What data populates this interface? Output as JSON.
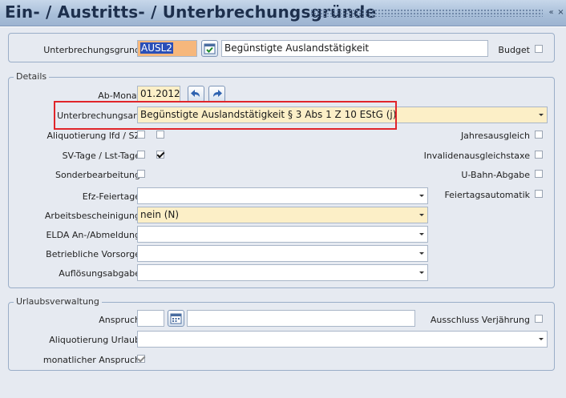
{
  "window": {
    "title": "Ein- / Austritts- / Unterbrechungsgründe",
    "btn_restore": "«",
    "btn_close": "×"
  },
  "top": {
    "grund_label": "Unterbrechungsgrund",
    "grund_code": "AUSL2",
    "grund_text": "Begünstigte Auslandstätigkeit",
    "budget_label": "Budget"
  },
  "details": {
    "legend": "Details",
    "abmonat_label": "Ab-Monat",
    "abmonat_value": "01.2012",
    "art_label": "Unterbrechungsart",
    "art_value": "Begünstigte Auslandstätigkeit § 3 Abs 1 Z 10 EStG (j)",
    "aliq_label": "Aliquotierung lfd / SZ",
    "svtage_label": "SV-Tage / Lst-Tage",
    "sonder_label": "Sonderbearbeitung",
    "efz_label": "Efz-Feiertage",
    "efz_value": "",
    "arbeit_label": "Arbeitsbescheinigung",
    "arbeit_value": "nein (N)",
    "elda_label": "ELDA An-/Abmeldung",
    "elda_value": "",
    "vorsorge_label": "Betriebliche Vorsorge",
    "vorsorge_value": "",
    "aufl_label": "Auflösungsabgabe",
    "aufl_value": "",
    "jahres_label": "Jahresausgleich",
    "invalid_label": "Invalidenausgleichstaxe",
    "ubahn_label": "U-Bahn-Abgabe",
    "feiertag_label": "Feiertagsautomatik"
  },
  "urlaub": {
    "legend": "Urlaubsverwaltung",
    "anspruch_label": "Anspruch",
    "anspruch_value": "",
    "anspruch_text": "",
    "ausschluss_label": "Ausschluss Verjährung",
    "aliq_label": "Aliquotierung Urlaub",
    "aliq_value": "",
    "monatlich_label": "monatlicher Anspruch"
  },
  "colors": {
    "highlight_box": "#e0252a",
    "field_yellow": "#fcefc7",
    "code_orange": "#f6b77c",
    "title_text": "#1d2f4c"
  }
}
